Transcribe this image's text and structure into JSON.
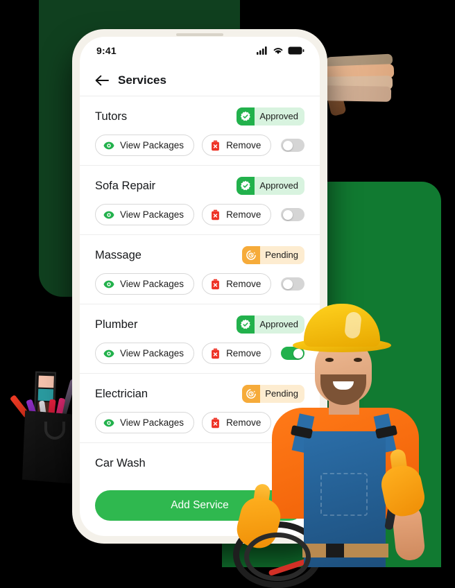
{
  "statusbar": {
    "time": "9:41",
    "signal_icon": "cellular-signal-icon",
    "wifi_icon": "wifi-icon",
    "battery_icon": "battery-icon"
  },
  "header": {
    "back_icon": "back-arrow-icon",
    "title": "Services"
  },
  "colors": {
    "approved_green": "#22b14c",
    "approved_bg": "#d8f3df",
    "pending_orange": "#f6ab3a",
    "pending_bg": "#fdecd0",
    "rejected_red": "#ee3124",
    "rejected_bg": "#fbd5d2",
    "cta_green": "#2fb84f",
    "page_black": "#000000",
    "shape_dark_green": "#10401F",
    "shape_bright_green": "#117A31",
    "phone_bezel": "#f4f1ea"
  },
  "actions": {
    "view_label": "View Packages",
    "remove_label": "Remove",
    "view_icon": "eye-icon",
    "remove_icon": "trash-icon"
  },
  "services": [
    {
      "name": "Tutors",
      "status": "Approved",
      "status_kind": "approved",
      "status_icon": "verified-badge-icon",
      "enabled": false
    },
    {
      "name": "Sofa Repair",
      "status": "Approved",
      "status_kind": "approved",
      "status_icon": "verified-badge-icon",
      "enabled": false
    },
    {
      "name": "Massage",
      "status": "Pending",
      "status_kind": "pending",
      "status_icon": "clock-refresh-icon",
      "enabled": false
    },
    {
      "name": "Plumber",
      "status": "Approved",
      "status_kind": "approved",
      "status_icon": "verified-badge-icon",
      "enabled": true
    },
    {
      "name": "Electrician",
      "status": "Pending",
      "status_kind": "pending",
      "status_icon": "clock-refresh-icon",
      "enabled": true
    },
    {
      "name": "Car Wash",
      "status": "",
      "status_kind": "rejected",
      "status_icon": "document-rejected-icon",
      "enabled": false
    }
  ],
  "cta": {
    "label": "Add Service"
  },
  "decor": {
    "towels_photo": "stack-of-folded-towels-photo",
    "cosmetics_photo": "cosmetics-bag-photo",
    "worker_photo": "smiling-worker-with-hardhat-photo"
  }
}
